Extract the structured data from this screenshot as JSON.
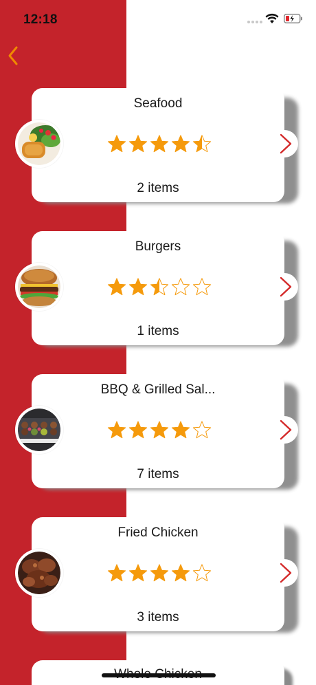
{
  "status_bar": {
    "time": "12:18"
  },
  "nav": {
    "back_icon": "chevron-left-icon"
  },
  "colors": {
    "accent_red": "#c4232b",
    "star_orange": "#f59a0c",
    "back_orange": "#f08a00"
  },
  "categories": [
    {
      "name": "Seafood",
      "rating": 4.5,
      "count_label": "2 items",
      "image": "seafood-dish"
    },
    {
      "name": "Burgers",
      "rating": 2.5,
      "count_label": "1 items",
      "image": "burger"
    },
    {
      "name": "BBQ & Grilled Sal...",
      "rating": 4,
      "count_label": "7 items",
      "image": "grilled-skewers"
    },
    {
      "name": "Fried Chicken",
      "rating": 4,
      "count_label": "3 items",
      "image": "fried-chicken"
    },
    {
      "name": "Whole Chicken",
      "count_label": "",
      "image": ""
    }
  ]
}
